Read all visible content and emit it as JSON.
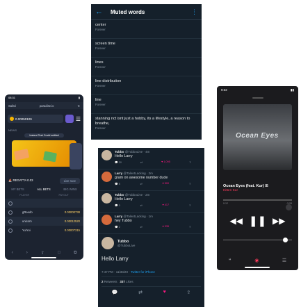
{
  "muted": {
    "title": "Muted words",
    "items": [
      {
        "word": "center",
        "duration": "Forever"
      },
      {
        "word": "screen time",
        "duration": "Forever"
      },
      {
        "word": "lines",
        "duration": "Forever"
      },
      {
        "word": "line distribution",
        "duration": "Forever"
      },
      {
        "word": "line",
        "duration": "Forever"
      },
      {
        "word": "stanning nct isnt just a hobby, its a lifestyle, a reason to breathe,",
        "duration": "Forever"
      }
    ]
  },
  "crypto": {
    "time": "08:31",
    "back": "Safari",
    "url": "paradise.io",
    "balance": "0.00050109",
    "news": "NEWS",
    "bonus_msg": "Instant Test Covid settled",
    "regatta": "REGATTA",
    "regatta_value": "0.03",
    "live": "Live race",
    "tabs": [
      "MY BETS",
      "ALL BETS",
      "BIG WINS"
    ],
    "headers": [
      "PLAYER",
      "PAYOUT"
    ],
    "rows": [
      {
        "name": "",
        "amount": ""
      },
      {
        "name": "gReedo",
        "amount": "0.00000738"
      },
      {
        "name": "unicorn",
        "amount": "0.00012520"
      },
      {
        "name": "YuiYui",
        "amount": "0.00007315"
      }
    ],
    "nav": [
      "‹",
      "›",
      "⇪",
      "□",
      "⧉"
    ]
  },
  "twitter": {
    "replies": [
      {
        "name": "Tubbo",
        "handle": "@TubboLive",
        "time": "4m",
        "text": "Hello Larry",
        "replies": "20",
        "rts": "",
        "likes": "1,095",
        "avatar": "tubbo"
      },
      {
        "name": "Larry",
        "handle": "@TalentLacking",
        "time": "2m",
        "text": "gram on awesome number dude",
        "replies": "5",
        "rts": "",
        "likes": "500",
        "avatar": "larry"
      },
      {
        "name": "Tubbo",
        "handle": "@TubboLive",
        "time": "2m",
        "text": "Hello Larry",
        "replies": "3",
        "rts": "",
        "likes": "417",
        "avatar": "tubbo"
      },
      {
        "name": "Larry",
        "handle": "@TalentLacking",
        "time": "1m",
        "text": "hey Tubbo",
        "replies": "2",
        "rts": "",
        "likes": "335",
        "avatar": "larry"
      }
    ],
    "main": {
      "name": "Tubbo",
      "handle": "@TubboLive",
      "text": "Hello Larry",
      "time": "7:47 PM · 11/30/20 · ",
      "client": "Twitter for iPhone",
      "retweets": "2",
      "retweets_label": "Retweets",
      "likes": "337",
      "likes_label": "Likes"
    }
  },
  "music": {
    "time": "9:32",
    "art_text": "Ocean Eyes",
    "title": "Ocean Eyes (feat. Kur) ⊞",
    "artist": "Kitten Kur",
    "elapsed": "0:12",
    "remaining": "-3:28"
  },
  "colors": {
    "twitter_blue": "#1da1f2",
    "like_pink": "#f91880",
    "music_accent": "#ff3b5c"
  }
}
